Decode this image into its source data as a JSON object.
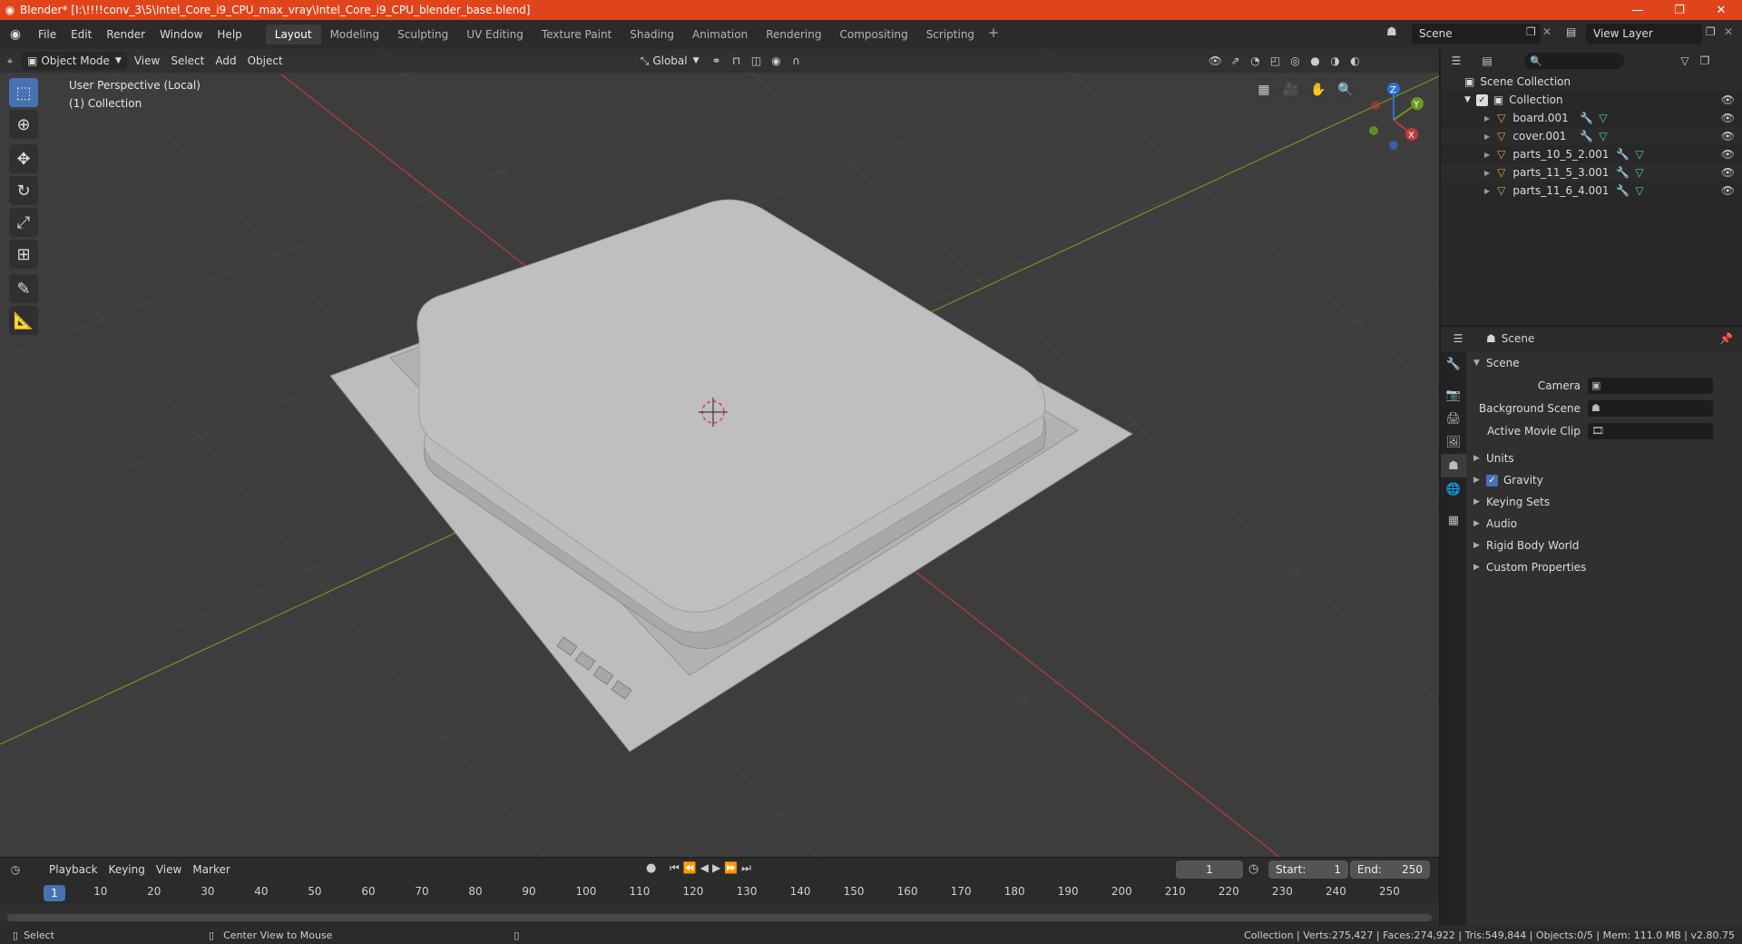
{
  "window": {
    "title": "Blender* [I:\\!!!!conv_3\\5\\Intel_Core_i9_CPU_max_vray\\Intel_Core_i9_CPU_blender_base.blend]",
    "minimize": "—",
    "maximize": "❐",
    "close": "✕"
  },
  "menu": {
    "file": "File",
    "edit": "Edit",
    "render": "Render",
    "window": "Window",
    "help": "Help"
  },
  "workspaces": [
    "Layout",
    "Modeling",
    "Sculpting",
    "UV Editing",
    "Texture Paint",
    "Shading",
    "Animation",
    "Rendering",
    "Compositing",
    "Scripting"
  ],
  "scene_name": "Scene",
  "view_layer": "View Layer",
  "viewport": {
    "mode": "Object Mode",
    "menus": [
      "View",
      "Select",
      "Add",
      "Object"
    ],
    "orientation": "Global",
    "info_line1": "User Perspective (Local)",
    "info_line2": "(1) Collection",
    "gizmo": {
      "z": "Z",
      "y": "Y",
      "x": "X"
    }
  },
  "timeline": {
    "menus": [
      "Playback",
      "Keying",
      "View",
      "Marker"
    ],
    "current_frame": "1",
    "start_label": "Start:",
    "start": "1",
    "end_label": "End:",
    "end": "250",
    "ticks": [
      "1",
      "10",
      "20",
      "30",
      "40",
      "50",
      "60",
      "70",
      "80",
      "90",
      "100",
      "110",
      "120",
      "130",
      "140",
      "150",
      "160",
      "170",
      "180",
      "190",
      "200",
      "210",
      "220",
      "230",
      "240",
      "250"
    ]
  },
  "status": {
    "select": "Select",
    "center_view": "Center View to Mouse",
    "stats": "Collection | Verts:275,427 | Faces:274,922 | Tris:549,844 | Objects:0/5 | Mem: 111.0 MB | v2.80.75"
  },
  "outliner": {
    "scene_collection": "Scene Collection",
    "collection": "Collection",
    "objects": [
      "board.001",
      "cover.001",
      "parts_10_5_2.001",
      "parts_11_5_3.001",
      "parts_11_6_4.001"
    ]
  },
  "properties": {
    "context": "Scene",
    "panel": "Scene",
    "camera_label": "Camera",
    "background_scene_label": "Background Scene",
    "active_movie_clip_label": "Active Movie Clip",
    "subpanels": [
      "Units",
      "Gravity",
      "Keying Sets",
      "Audio",
      "Rigid Body World",
      "Custom Properties"
    ]
  },
  "colors": {
    "titlebar": "#e0441c",
    "accent": "#4772b3",
    "viewport_bg": "#3d3d3d",
    "x_axis": "#c0393b",
    "y_axis": "#6a9a1f"
  }
}
